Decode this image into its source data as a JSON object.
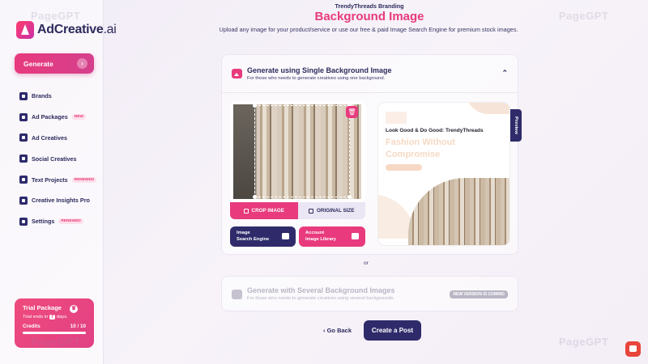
{
  "app": {
    "logo_text": "AdCreative",
    "logo_suffix": ".ai"
  },
  "sidebar": {
    "generate_label": "Generate",
    "items": [
      {
        "label": "Brands",
        "badge": ""
      },
      {
        "label": "Ad Packages",
        "badge": "NEW"
      },
      {
        "label": "Ad Creatives",
        "badge": ""
      },
      {
        "label": "Social Creatives",
        "badge": ""
      },
      {
        "label": "Text Projects",
        "badge": "RENEWED"
      },
      {
        "label": "Creative Insights Pro",
        "badge": ""
      },
      {
        "label": "Settings",
        "badge": "RENEWED"
      }
    ],
    "trial": {
      "title": "Trial Package",
      "days_prefix": "Trial ends in",
      "days_value": "7",
      "days_suffix": "days.",
      "credits_label": "Credits",
      "credits_value": "10 / 10",
      "credits_fraction": 1.0
    }
  },
  "header": {
    "brand": "TrendyThreads Branding",
    "title": "Background Image",
    "subtitle": "Upload any image for your product/service or use our free & paid Image Search Engine for premium stock images."
  },
  "single_card": {
    "title": "Generate using Single Background Image",
    "subtitle": "For those who needs to generate creatives using one background.",
    "crop_tab": "CROP IMAGE",
    "original_tab": "ORIGINAL SIZE",
    "search_btn_line1": "Image",
    "search_btn_line2": "Search Engine",
    "library_btn_line1": "Account",
    "library_btn_line2": "Image Library",
    "preview_tab": "Preview",
    "preview": {
      "headline": "Look Good & Do Good: TrendyThreads",
      "tagline": "Fashion Without Compromise"
    }
  },
  "divider_or": "or",
  "multi_card": {
    "title": "Generate with Several Background Images",
    "subtitle": "For those who needs to generate creatives using several backgrounds.",
    "badge": "NEW VERSION IS COMING"
  },
  "footer": {
    "go_back": "Go Back",
    "create": "Create a Post"
  },
  "watermark": "PageGPT",
  "colors": {
    "accent": "#e83a7d",
    "navy": "#2f2b6b"
  }
}
